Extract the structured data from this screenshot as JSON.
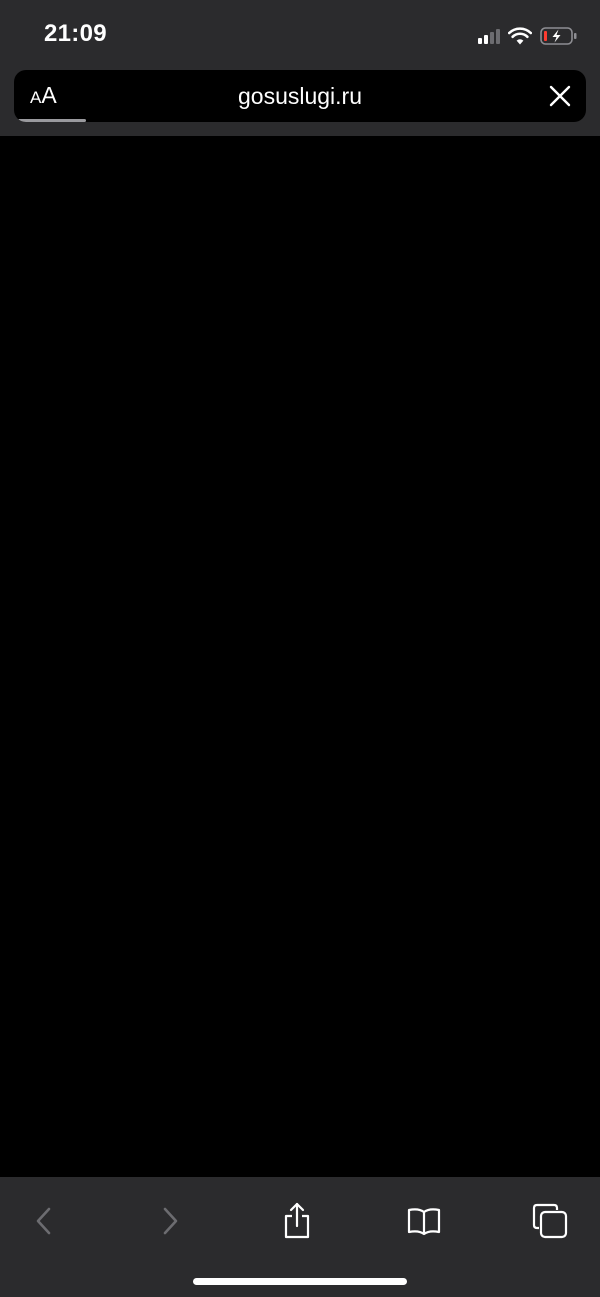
{
  "status_bar": {
    "time": "21:09",
    "signal_bars_active": 2,
    "signal_bars_total": 4,
    "wifi_icon": "wifi-icon",
    "battery_icon": "battery-charging-low-icon",
    "battery_color": "#ff3b30"
  },
  "address_bar": {
    "text_size_label_small": "A",
    "text_size_label_large": "A",
    "url": "gosuslugi.ru",
    "close_icon": "close-icon",
    "load_progress": 0.12
  },
  "toolbar": {
    "back_icon": "chevron-left-icon",
    "forward_icon": "chevron-right-icon",
    "share_icon": "share-icon",
    "bookmarks_icon": "book-icon",
    "tabs_icon": "tabs-icon",
    "enabled_color": "#ffffff",
    "disabled_color": "#6c6c70"
  }
}
